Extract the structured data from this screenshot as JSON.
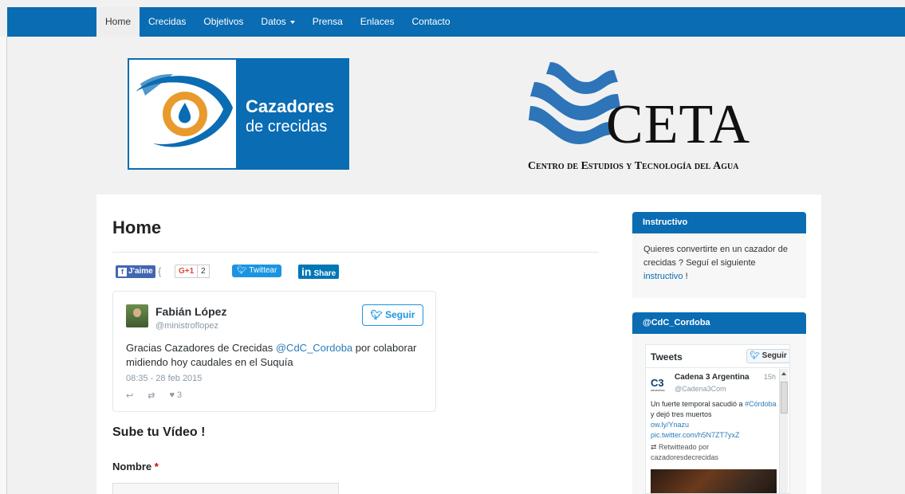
{
  "nav": {
    "items": [
      {
        "label": "Home",
        "active": true
      },
      {
        "label": "Crecidas"
      },
      {
        "label": "Objetivos"
      },
      {
        "label": "Datos",
        "dropdown": true
      },
      {
        "label": "Prensa"
      },
      {
        "label": "Enlaces"
      },
      {
        "label": "Contacto"
      }
    ]
  },
  "logos": {
    "cazadores": {
      "line1": "Cazadores",
      "line2": "de crecidas"
    },
    "ceta": {
      "word": "CETA",
      "subtitle": "Centro de Estudios y Tecnología del Agua"
    }
  },
  "main": {
    "title": "Home",
    "social": {
      "facebook_label": "J'aime",
      "gplus_label": "G+1",
      "gplus_count": "2",
      "twitter_label": "Twittear",
      "linkedin_label": "Share"
    },
    "tweet": {
      "author_name": "Fabián López",
      "author_handle": "@ministroflopez",
      "follow_label": "Seguir",
      "text_before": "Gracias Cazadores de Crecidas ",
      "mention": "@CdC_Cordoba",
      "text_after": " por colaborar midiendo hoy caudales en el Suquía",
      "date": "08:35 - 28 feb 2015",
      "likes": "3"
    },
    "video_title": "Sube tu Vídeo !",
    "form": {
      "nombre_label": "Nombre",
      "required_mark": "*"
    }
  },
  "sidebar": {
    "instructivo": {
      "title": "Instructivo",
      "text_before": "Quieres convertirte en un cazador de crecidas ? Seguí el siguiente ",
      "link": "instructivo",
      "text_after": " !"
    },
    "twitter_widget": {
      "title": "@CdC_Cordoba",
      "header": "Tweets",
      "follow_label": "Seguir",
      "logo_text": "C3",
      "logo_sub": "ARGENTINA",
      "tweet_author": "Cadena 3 Argentina",
      "tweet_time": "15h",
      "tweet_handle": "@Cadena3Com",
      "tweet_text_1": "Un fuerte temporal sacudió a ",
      "tweet_hashtag": "#Córdoba",
      "tweet_text_2": " y dejó tres muertos",
      "tweet_link1": "ow.ly/Ynazu",
      "tweet_link2": "pic.twitter.com/h5N7ZT7yxZ",
      "retweet_line1": "Retwitteado por",
      "retweet_line2": "cazadoresdecrecidas"
    }
  },
  "colors": {
    "brand_blue": "#0a6cb3",
    "twitter_blue": "#1b95e0"
  }
}
